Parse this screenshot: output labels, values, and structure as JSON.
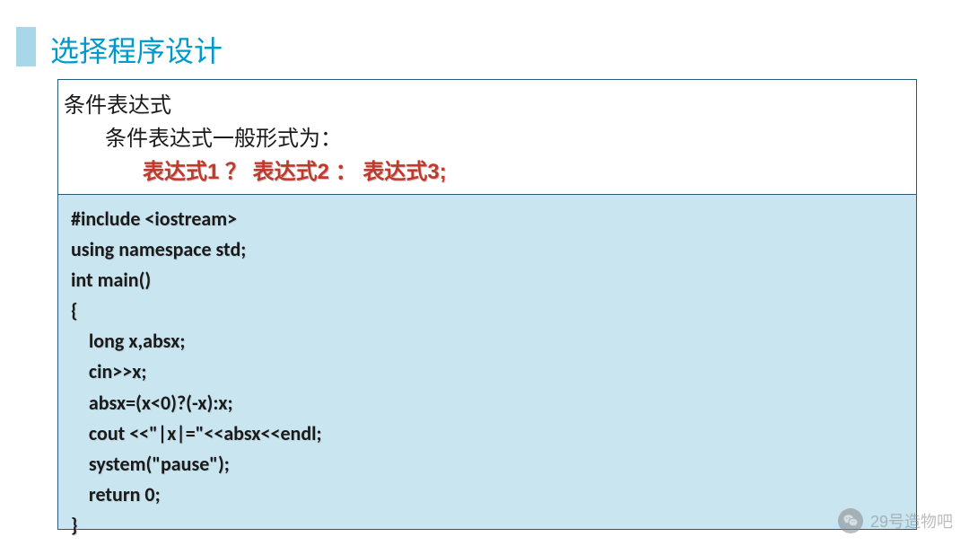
{
  "title": "选择程序设计",
  "box_top": {
    "line1": "条件表达式",
    "line2": "条件表达式一般形式为：",
    "line3": "表达式1 ？ 表达式2 ： 表达式3;"
  },
  "code": {
    "lines": [
      "#include <iostream>",
      "using namespace std;",
      "int main()",
      "{",
      "    long x,absx;",
      "    cin>>x;",
      "    absx=(x<0)?(-x):x;",
      "    cout <<\"|x|=\"<<absx<<endl;",
      "    system(\"pause\");",
      "    return 0;",
      "}"
    ]
  },
  "watermark": {
    "text": "29号造物吧"
  }
}
